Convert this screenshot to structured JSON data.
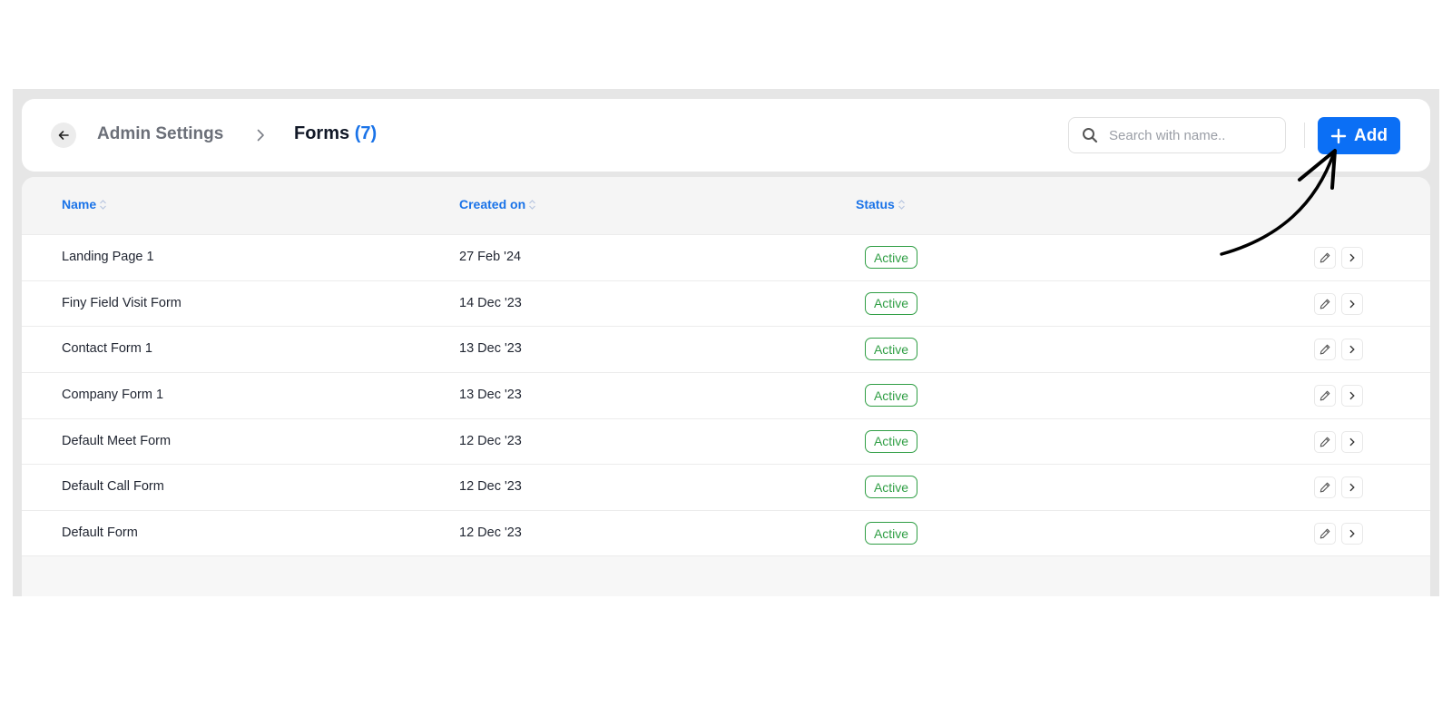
{
  "header": {
    "breadcrumb_parent": "Admin Settings",
    "title": "Forms",
    "count": "(7)"
  },
  "search": {
    "placeholder": "Search with name.."
  },
  "add_button": {
    "label": "Add"
  },
  "table": {
    "columns": [
      "Name",
      "Created on",
      "Status"
    ],
    "rows": [
      {
        "name": "Landing Page 1",
        "created": "27 Feb '24",
        "status": "Active"
      },
      {
        "name": "Finy Field Visit Form",
        "created": "14 Dec '23",
        "status": "Active"
      },
      {
        "name": "Contact Form 1",
        "created": "13 Dec '23",
        "status": "Active"
      },
      {
        "name": "Company Form 1",
        "created": "13 Dec '23",
        "status": "Active"
      },
      {
        "name": "Default Meet Form",
        "created": "12 Dec '23",
        "status": "Active"
      },
      {
        "name": "Default Call Form",
        "created": "12 Dec '23",
        "status": "Active"
      },
      {
        "name": "Default Form",
        "created": "12 Dec '23",
        "status": "Active"
      }
    ]
  },
  "colors": {
    "accent": "#0b6ff5",
    "link": "#1a73e8",
    "status_active": "#2f9e44"
  },
  "icons": {
    "back": "arrow-left-icon",
    "separator": "chevron-right-icon",
    "search": "search-icon",
    "add": "plus-icon",
    "sort": "sort-icon",
    "edit": "pencil-icon",
    "open": "chevron-right-icon"
  }
}
